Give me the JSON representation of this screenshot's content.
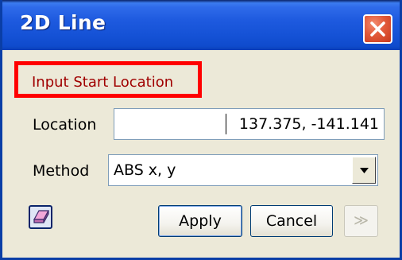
{
  "window": {
    "title": "2D Line"
  },
  "prompt": {
    "text": "Input Start Location"
  },
  "location": {
    "label": "Location",
    "value": "137.375, -141.141"
  },
  "method": {
    "label": "Method",
    "selected": "ABS x, y"
  },
  "buttons": {
    "apply": "Apply",
    "cancel": "Cancel",
    "more": "≫"
  },
  "icons": {
    "close": "close-icon",
    "dropdown": "chevron-down-icon",
    "eraser": "eraser-icon",
    "more": "double-chevron-right-icon"
  },
  "colors": {
    "titlebar": "#1e5adf",
    "prompt_border": "#ff0000",
    "prompt_text": "#a00000",
    "dialog_bg": "#ece9d8"
  }
}
